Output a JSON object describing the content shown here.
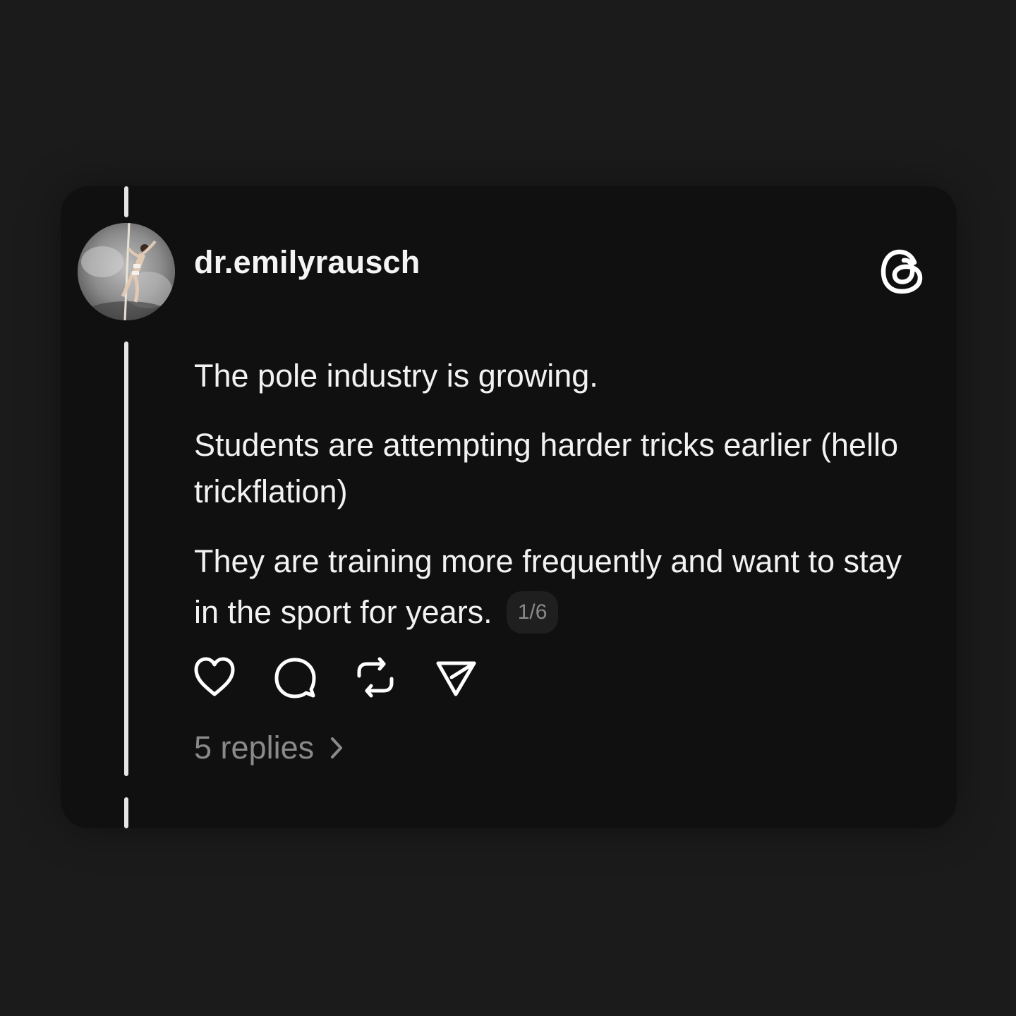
{
  "post": {
    "username": "dr.emilyrausch",
    "paragraphs": [
      "The pole industry is growing.",
      "Students are attempting harder tricks earlier (hello trickflation)",
      "They are training more frequently and want to stay in the sport for years."
    ],
    "page_indicator": "1/6",
    "replies_label": "5 replies"
  },
  "icons": {
    "logo": "threads-logo-icon",
    "like": "heart-icon",
    "reply": "comment-bubble-icon",
    "repost": "repost-arrows-icon",
    "share": "send-paper-plane-icon",
    "replies_arrow": "chevron-right-icon"
  },
  "colors": {
    "background": "#1b1b1b",
    "card": "#101010",
    "text_primary": "#f2f2f2",
    "text_secondary": "#8a8a8a",
    "badge_bg": "#1f1f1f"
  }
}
